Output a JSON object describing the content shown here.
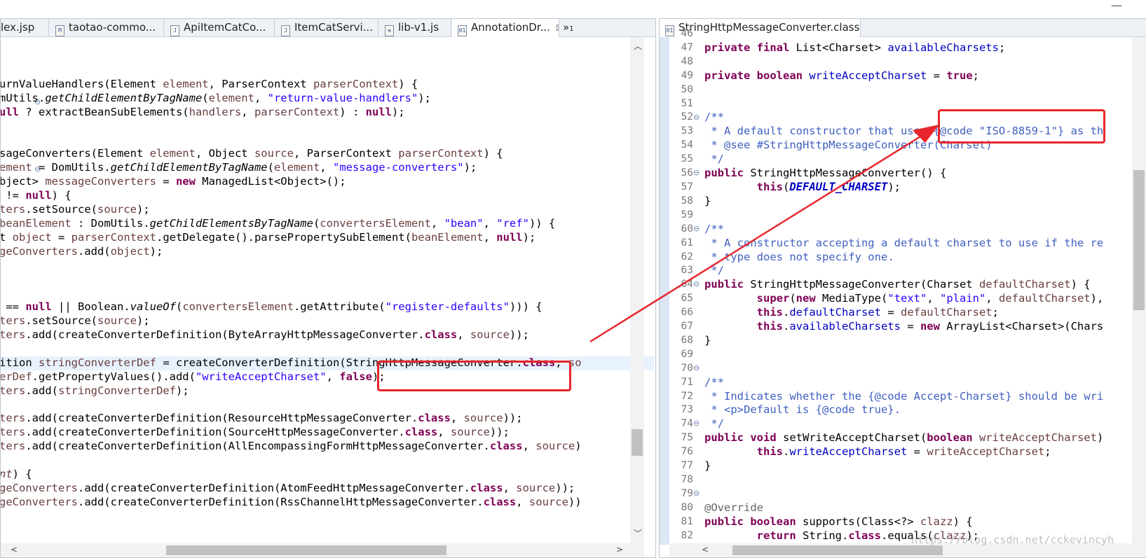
{
  "left_pane": {
    "tabs": [
      {
        "label": "lex.jsp",
        "icon": "jsp-file-icon"
      },
      {
        "label": "taotao-commo...",
        "icon": "maven-file-icon"
      },
      {
        "label": "ApiItemCatCo...",
        "icon": "java-file-icon"
      },
      {
        "label": "ItemCatServi...",
        "icon": "java-file-icon"
      },
      {
        "label": "lib-v1.js",
        "icon": "js-file-icon"
      },
      {
        "label": "AnnotationDr...",
        "icon": "class-file-icon",
        "close": "☒"
      }
    ],
    "overflow_label": "»",
    "overflow_count": "1"
  },
  "right_pane": {
    "tab": {
      "label": "StringHttpMessageConverter.class",
      "icon": "class-file-icon",
      "close": "☒"
    }
  },
  "code_left": [
    "",
    "",
    "",
    "urnValueHandlers(Element element, ParserContext parserContext) {",
    "mUtils.getChildElementByTagName(element, \"return-value-handlers\");",
    "ull ? extractBeanSubElements(handlers, parserContext) : null);",
    "",
    "",
    "sageConverters(Element element, Object source, ParserContext parserContext) {",
    "ement = DomUtils.getChildElementByTagName(element, \"message-converters\");",
    "bject> messageConverters = new ManagedList<Object>();",
    " != null) {",
    "ters.setSource(source);",
    "beanElement : DomUtils.getChildElementsByTagName(convertersElement, \"bean\", \"ref\")) {",
    "t object = parserContext.getDelegate().parsePropertySubElement(beanElement, null);",
    "geConverters.add(object);",
    "",
    "",
    "",
    " == null || Boolean.valueOf(convertersElement.getAttribute(\"register-defaults\"))) {",
    "ters.setSource(source);",
    "ters.add(createConverterDefinition(ByteArrayHttpMessageConverter.class, source));",
    "",
    "ition stringConverterDef = createConverterDefinition(StringHttpMessageConverter.class, so",
    "erDef.getPropertyValues().add(\"writeAcceptCharset\", false);",
    "ters.add(stringConverterDef);",
    "",
    "ters.add(createConverterDefinition(ResourceHttpMessageConverter.class, source));",
    "ters.add(createConverterDefinition(SourceHttpMessageConverter.class, source));",
    "ters.add(createConverterDefinition(AllEncompassingFormHttpMessageConverter.class, source)",
    "",
    "nt) {",
    "geConverters.add(createConverterDefinition(AtomFeedHttpMessageConverter.class, source));",
    "geConverters.add(createConverterDefinition(RssChannelHttpMessageConverter.class, source))"
  ],
  "code_right": {
    "line_numbers": [
      "46",
      "47",
      "48",
      "49",
      "50",
      "51",
      "52",
      "53",
      "54",
      "55",
      "56",
      "57",
      "58",
      "59",
      "60",
      "61",
      "62",
      "63",
      "64",
      "65",
      "66",
      "67",
      "68",
      "69",
      "70",
      "71",
      "72",
      "73",
      "74",
      "75",
      "76",
      "77",
      "78",
      "79",
      "80",
      "81",
      "82"
    ],
    "lines": [
      "",
      "private final List<Charset> availableCharsets;",
      "",
      "private boolean writeAcceptCharset = true;",
      "",
      "",
      "/**",
      " * A default constructor that uses {@code \"ISO-8859-1\"} as th",
      " * @see #StringHttpMessageConverter(Charset)",
      " */",
      "public StringHttpMessageConverter() {",
      "        this(DEFAULT_CHARSET);",
      "}",
      "",
      "/**",
      " * A constructor accepting a default charset to use if the re",
      " * type does not specify one.",
      " */",
      "public StringHttpMessageConverter(Charset defaultCharset) {",
      "        super(new MediaType(\"text\", \"plain\", defaultCharset),",
      "        this.defaultCharset = defaultCharset;",
      "        this.availableCharsets = new ArrayList<Charset>(Chars",
      "}",
      "",
      "",
      "/**",
      " * Indicates whether the {@code Accept-Charset} should be wri",
      " * <p>Default is {@code true}.",
      " */",
      "public void setWriteAcceptCharset(boolean writeAcceptCharset)",
      "        this.writeAcceptCharset = writeAcceptCharset;",
      "}",
      "",
      "",
      "@Override",
      "public boolean supports(Class<?> clazz) {",
      "        return String.class.equals(clazz);"
    ]
  },
  "watermark": "https://blog.csdn.net/cckevincyh",
  "colors": {
    "keyword": "#7f0055",
    "string": "#2a00ff",
    "field": "#0000c0",
    "comment": "#3f5fbf",
    "highlight_box": "#e8262b",
    "arrow": "#e8262b"
  }
}
